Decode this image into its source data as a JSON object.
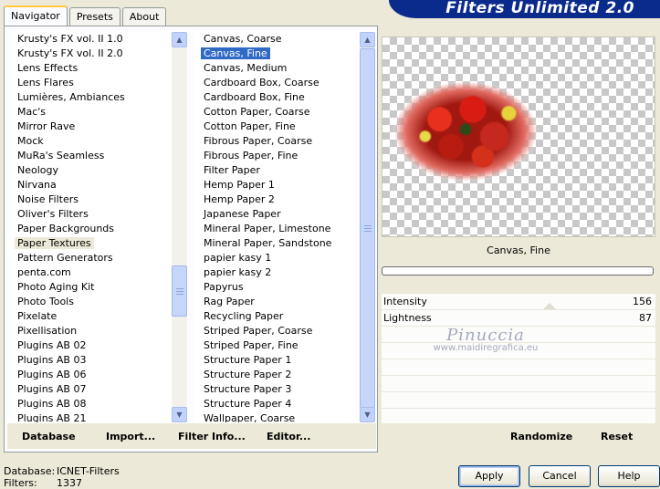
{
  "tabs": [
    "Navigator",
    "Presets",
    "About"
  ],
  "banner": "Filters Unlimited 2.0",
  "categories": {
    "items": [
      "Krusty's FX vol. II 1.0",
      "Krusty's FX vol. II 2.0",
      "Lens Effects",
      "Lens Flares",
      "Lumières, Ambiances",
      "Mac's",
      "Mirror Rave",
      "Mock",
      "MuRa's Seamless",
      "Neology",
      "Nirvana",
      "Noise Filters",
      "Oliver's Filters",
      "Paper Backgrounds",
      "Paper Textures",
      "Pattern Generators",
      "penta.com",
      "Photo Aging Kit",
      "Photo Tools",
      "Pixelate",
      "Pixellisation",
      "Plugins AB 02",
      "Plugins AB 03",
      "Plugins AB 06",
      "Plugins AB 07",
      "Plugins AB 08",
      "Plugins AB 21"
    ],
    "selected": "Paper Textures"
  },
  "filters": {
    "items": [
      "Canvas, Coarse",
      "Canvas, Fine",
      "Canvas, Medium",
      "Cardboard Box, Coarse",
      "Cardboard Box, Fine",
      "Cotton Paper, Coarse",
      "Cotton Paper, Fine",
      "Fibrous Paper, Coarse",
      "Fibrous Paper, Fine",
      "Filter Paper",
      "Hemp Paper 1",
      "Hemp Paper 2",
      "Japanese Paper",
      "Mineral Paper, Limestone",
      "Mineral Paper, Sandstone",
      "papier kasy 1",
      "papier kasy 2",
      "Papyrus",
      "Rag Paper",
      "Recycling Paper",
      "Striped Paper, Coarse",
      "Striped Paper, Fine",
      "Structure Paper 1",
      "Structure Paper 2",
      "Structure Paper 3",
      "Structure Paper 4",
      "Wallpaper, Coarse"
    ],
    "selected": "Canvas, Fine"
  },
  "left_buttons": {
    "database": "Database",
    "import": "Import...",
    "filter_info": "Filter Info...",
    "editor": "Editor..."
  },
  "preview": {
    "effect_name": "Canvas, Fine"
  },
  "params": [
    {
      "label": "Intensity",
      "value": "156"
    },
    {
      "label": "Lightness",
      "value": "87"
    }
  ],
  "watermark": {
    "line1": "Pinuccia",
    "line2": "www.maidiregrafica.eu"
  },
  "right_buttons": {
    "randomize": "Randomize",
    "reset": "Reset"
  },
  "status": {
    "database_label": "Database:",
    "database_value": "ICNET-Filters",
    "filters_label": "Filters:",
    "filters_value": "1337"
  },
  "dialog_buttons": {
    "apply": "Apply",
    "cancel": "Cancel",
    "help": "Help"
  },
  "colors": {
    "selection": "#316ac5",
    "banner": "#0a2a8c"
  }
}
